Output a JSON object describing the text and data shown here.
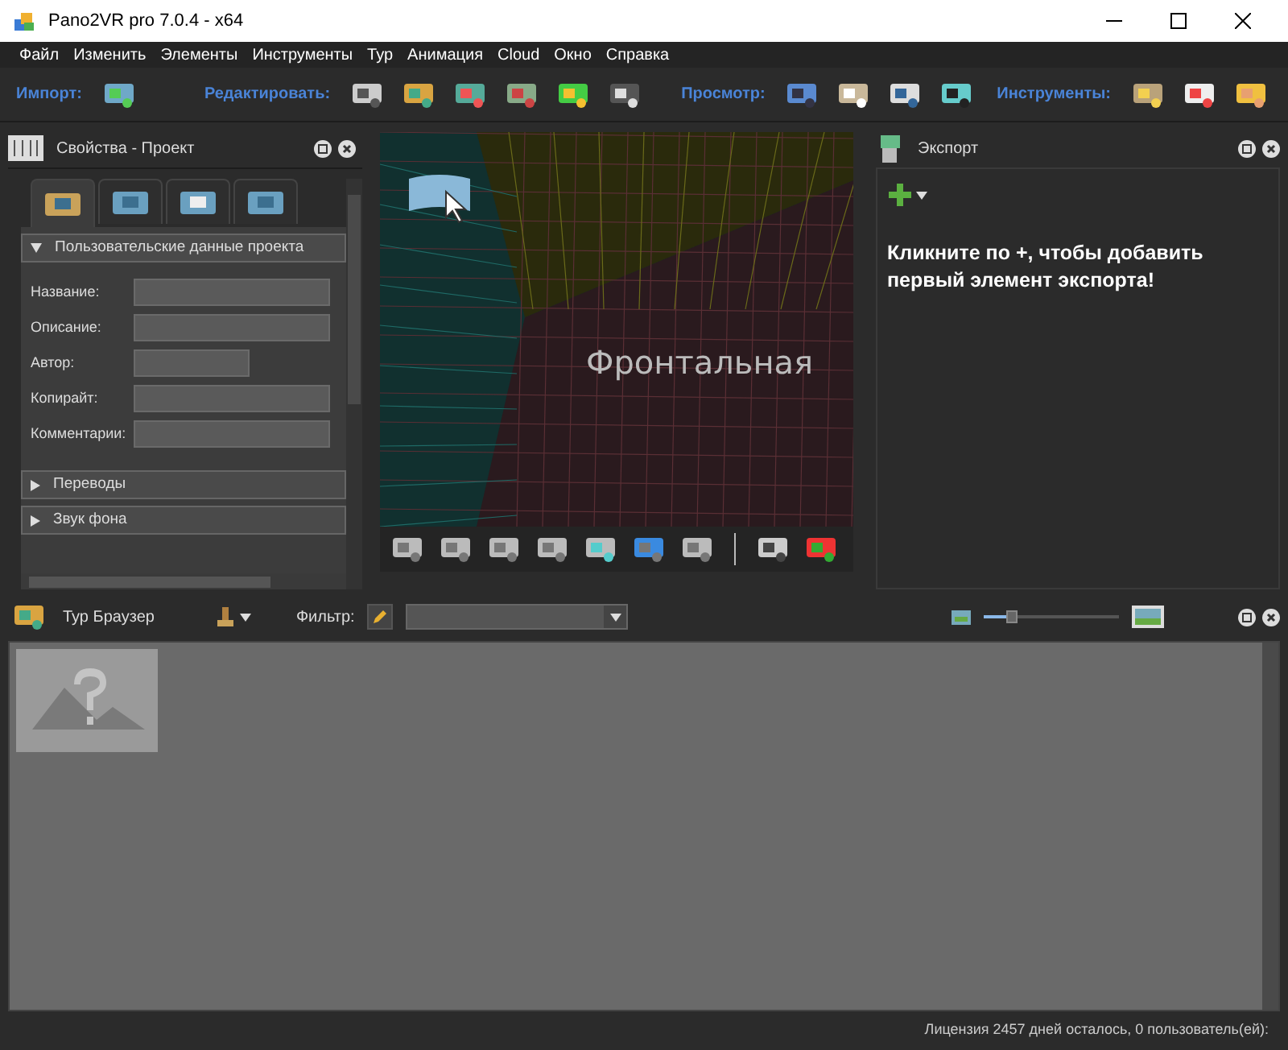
{
  "window": {
    "title": "Pano2VR pro 7.0.4 - x64"
  },
  "menu": [
    "Файл",
    "Изменить",
    "Элементы",
    "Инструменты",
    "Тур",
    "Анимация",
    "Cloud",
    "Окно",
    "Справка"
  ],
  "toolbar": [
    {
      "label": "Импорт:"
    },
    {
      "label": "Редактировать:"
    },
    {
      "label": "Просмотр:"
    },
    {
      "label": "Инструменты:"
    }
  ],
  "properties": {
    "title": "Свойства - Проект",
    "tabs": [
      {
        "selected": true
      },
      {
        "selected": false
      },
      {
        "selected": false
      },
      {
        "selected": false
      }
    ],
    "sections": [
      {
        "title": "Пользовательские данные проекта",
        "expanded": true,
        "fields": [
          {
            "label": "Название:"
          },
          {
            "label": "Описание:"
          },
          {
            "label": "Автор:"
          },
          {
            "label": "Копирайт:"
          },
          {
            "label": "Комментарии:"
          }
        ]
      },
      {
        "title": "Переводы",
        "expanded": false
      },
      {
        "title": "Звук фона",
        "expanded": false
      }
    ]
  },
  "viewer": {
    "face_label": "Фронтальная"
  },
  "export": {
    "title": "Экспорт",
    "message": "Кликните по +, чтобы добавить первый элемент экспорта!"
  },
  "tour_browser": {
    "title": "Тур Браузер",
    "filter_label": "Фильтр:",
    "zoom": {
      "level": 0.2
    }
  },
  "status_bar": "Лицензия 2457 дней осталось, 0 пользователь(ей):"
}
